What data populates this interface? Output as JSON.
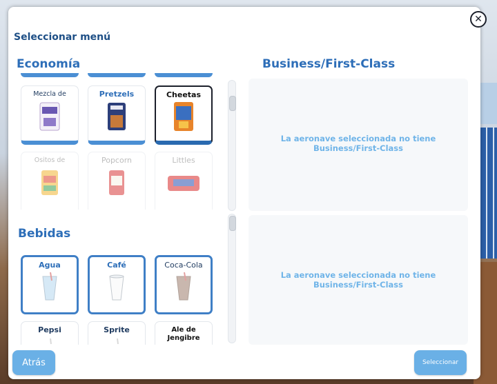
{
  "modal": {
    "title": "Seleccionar menú",
    "close_symbol": "✕"
  },
  "economy": {
    "heading": "Economía",
    "snacks": [
      {
        "label": "Mezcla de",
        "state": "normal",
        "icon": "trail-mix-bag-icon"
      },
      {
        "label": "Pretzels",
        "state": "normal",
        "icon": "pretzels-bag-icon"
      },
      {
        "label": "Cheetas",
        "state": "selected",
        "icon": "cheetas-bag-icon"
      },
      {
        "label": "Ositos de",
        "state": "disabled",
        "icon": "gummy-bears-bag-icon"
      },
      {
        "label": "Popcorn",
        "state": "disabled",
        "icon": "popcorn-bag-icon"
      },
      {
        "label": "Littles",
        "state": "disabled",
        "icon": "littles-bag-icon"
      }
    ]
  },
  "drinks": {
    "heading": "Bebidas",
    "items": [
      {
        "label": "Agua",
        "state": "selected",
        "icon": "water-cup-icon"
      },
      {
        "label": "Café",
        "state": "selected",
        "icon": "coffee-cup-icon"
      },
      {
        "label": "Coca-Cola",
        "state": "selected",
        "icon": "cola-cup-icon"
      },
      {
        "label": "Pepsi",
        "state": "normal",
        "icon": "pepsi-cup-icon"
      },
      {
        "label": "Sprite",
        "state": "normal",
        "icon": "sprite-cup-icon"
      },
      {
        "label": "Ale de Jengibre",
        "state": "normal",
        "icon": "ginger-ale-cup-icon"
      }
    ]
  },
  "business": {
    "heading": "Business/First-Class",
    "food_message": "La aeronave seleccionada no tiene Business/First-Class",
    "drinks_message": "La aeronave seleccionada no tiene Business/First-Class"
  },
  "footer": {
    "back_label": "Atrás",
    "select_label": "Seleccionar"
  },
  "colors": {
    "accent": "#4b8fd4",
    "heading": "#2d6eb8",
    "message": "#6fb4e8",
    "button": "#6ab0e6"
  }
}
